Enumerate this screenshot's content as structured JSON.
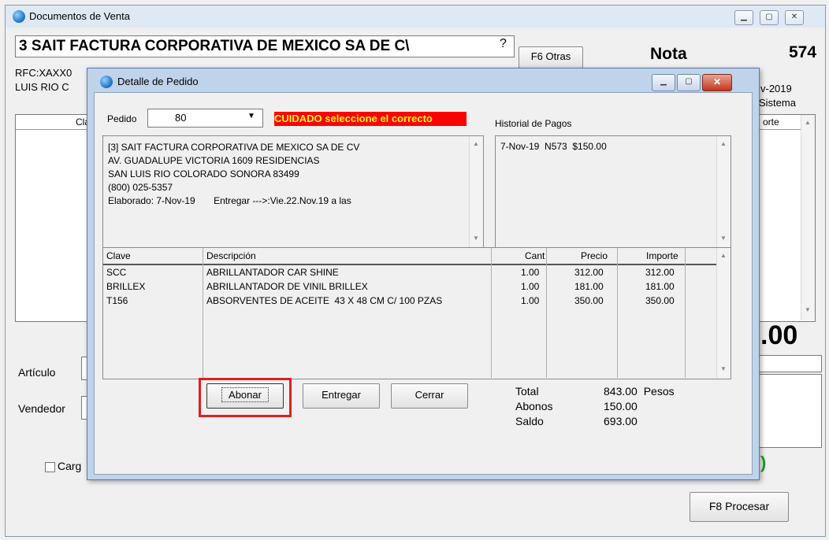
{
  "outer": {
    "title": "Documentos de Venta",
    "client_name": "3 SAIT FACTURA CORPORATIVA DE MEXICO SA DE C\\",
    "help_mark": "?",
    "f6_button": "F6 Otras",
    "doc_type": "Nota",
    "doc_number": "574",
    "rfc": "RFC:XAXX0",
    "city": "LUIS RIO C",
    "date": "v-2019",
    "sistema": "Sistema",
    "table_col_clave": "Cla",
    "table_col_importe": "orte",
    "total_fragment": ".00",
    "articulo_label": "Artículo",
    "vendedor_label": "Vendedor",
    "cargo_label": "Carg",
    "green_fragment": ")",
    "procesar_button": "F8 Procesar"
  },
  "dialog": {
    "title": "Detalle de Pedido",
    "pedido_label": "Pedido",
    "pedido_value": "80",
    "warning": "CUIDADO seleccione el correcto",
    "historial_label": "Historial de Pagos",
    "address_lines": [
      "[3] SAIT FACTURA CORPORATIVA DE MEXICO SA DE CV",
      "AV. GUADALUPE VICTORIA 1609 RESIDENCIAS",
      "SAN LUIS RIO COLORADO SONORA 83499",
      "(800) 025-5357"
    ],
    "elaborado": "Elaborado: 7-Nov-19",
    "entregar_note": "Entregar --->:Vie.22.Nov.19 a las",
    "payments": [
      "7-Nov-19  N573  $150.00"
    ],
    "columns": {
      "clave": "Clave",
      "descripcion": "Descripción",
      "cant": "Cant",
      "precio": "Precio",
      "importe": "Importe"
    },
    "rows": [
      {
        "clave": "SCC",
        "descripcion": "ABRILLANTADOR CAR SHINE",
        "cant": "1.00",
        "precio": "312.00",
        "importe": "312.00"
      },
      {
        "clave": "BRILLEX",
        "descripcion": "ABRILLANTADOR DE VINIL BRILLEX",
        "cant": "1.00",
        "precio": "181.00",
        "importe": "181.00"
      },
      {
        "clave": "T156",
        "descripcion": "ABSORVENTES DE ACEITE  43 X 48 CM C/ 100 PZAS",
        "cant": "1.00",
        "precio": "350.00",
        "importe": "350.00"
      }
    ],
    "buttons": {
      "abonar": "Abonar",
      "entregar": "Entregar",
      "cerrar": "Cerrar"
    },
    "totals": {
      "total_label": "Total",
      "total_value": "843.00",
      "currency": "Pesos",
      "abonos_label": "Abonos",
      "abonos_value": "150.00",
      "saldo_label": "Saldo",
      "saldo_value": "693.00"
    },
    "highlight_color": "#e0201f",
    "warning_bg": "#ff0000",
    "warning_fg": "#ffff00"
  }
}
